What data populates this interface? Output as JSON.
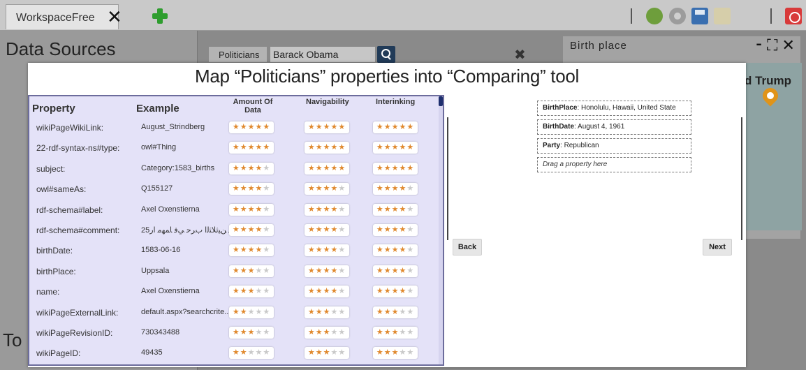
{
  "workspace": {
    "tab_label": "WorkspaceFree",
    "close_glyph": "✕",
    "toolbar_icons": [
      "refresh-icon",
      "gear-icon",
      "save-icon",
      "folder-icon",
      "power-icon"
    ]
  },
  "background": {
    "data_sources_title": "Data Sources",
    "tools_title": "To",
    "search": {
      "category": "Politicians",
      "value": "Barack Obama",
      "clear_glyph": "✖"
    },
    "birth_panel": {
      "title": "Birth place",
      "controls": "⁃ ⛶ ✕",
      "map_label": "d Trump"
    }
  },
  "modal": {
    "title": "Map “Politicians” properties into “Comparing” tool",
    "columns": {
      "property": "Property",
      "example": "Example",
      "amount": "Amount Of Data",
      "navigability": "Navigability",
      "interlinking": "Interinking"
    },
    "rows": [
      {
        "property": "wikiPageWikiLink:",
        "example": "August_Strindberg",
        "amount": 5,
        "navigability": 5,
        "interlinking": 5
      },
      {
        "property": "22-rdf-syntax-ns#type:",
        "example": "owl#Thing",
        "amount": 5,
        "navigability": 5,
        "interlinking": 5
      },
      {
        "property": "subject:",
        "example": "Category:1583_births",
        "amount": 4,
        "navigability": 5,
        "interlinking": 5
      },
      {
        "property": "owl#sameAs:",
        "example": "Q155127",
        "amount": 4,
        "navigability": 4,
        "interlinking": 4
      },
      {
        "property": "rdf-schema#label:",
        "example": "Axel Oxenstierna",
        "amount": 4,
        "navigability": 4,
        "interlinking": 4
      },
      {
        "property": "rdf-schema#comment:",
        "example": "25ﺎﻣﺎﻋ ﻦﯿﺛﻼﺜﻟا بﺮﺣ ﻲﻓ ﺎﻤﮭﻣ ار.",
        "amount": 4,
        "navigability": 4,
        "interlinking": 4
      },
      {
        "property": "birthDate:",
        "example": "1583-06-16",
        "amount": 4,
        "navigability": 4,
        "interlinking": 4
      },
      {
        "property": "birthPlace:",
        "example": "Uppsala",
        "amount": 3,
        "navigability": 4,
        "interlinking": 4
      },
      {
        "property": "name:",
        "example": "Axel Oxenstierna",
        "amount": 3,
        "navigability": 4,
        "interlinking": 4
      },
      {
        "property": "wikiPageExternalLink:",
        "example": "default.aspx?searchcrite...",
        "amount": 2,
        "navigability": 3,
        "interlinking": 3
      },
      {
        "property": "wikiPageRevisionID:",
        "example": "730343488",
        "amount": 3,
        "navigability": 3,
        "interlinking": 3
      },
      {
        "property": "wikiPageID:",
        "example": "49435",
        "amount": 2,
        "navigability": 3,
        "interlinking": 3
      }
    ],
    "mapped": [
      {
        "key": "BirthPlace",
        "value": ": Honolulu, Hawaii, United State"
      },
      {
        "key": "BirthDate",
        "value": ": August 4, 1961"
      },
      {
        "key": "Party",
        "value": ": Republican"
      }
    ],
    "drop_placeholder": "Drag a property here",
    "back_label": "Back",
    "next_label": "Next"
  }
}
